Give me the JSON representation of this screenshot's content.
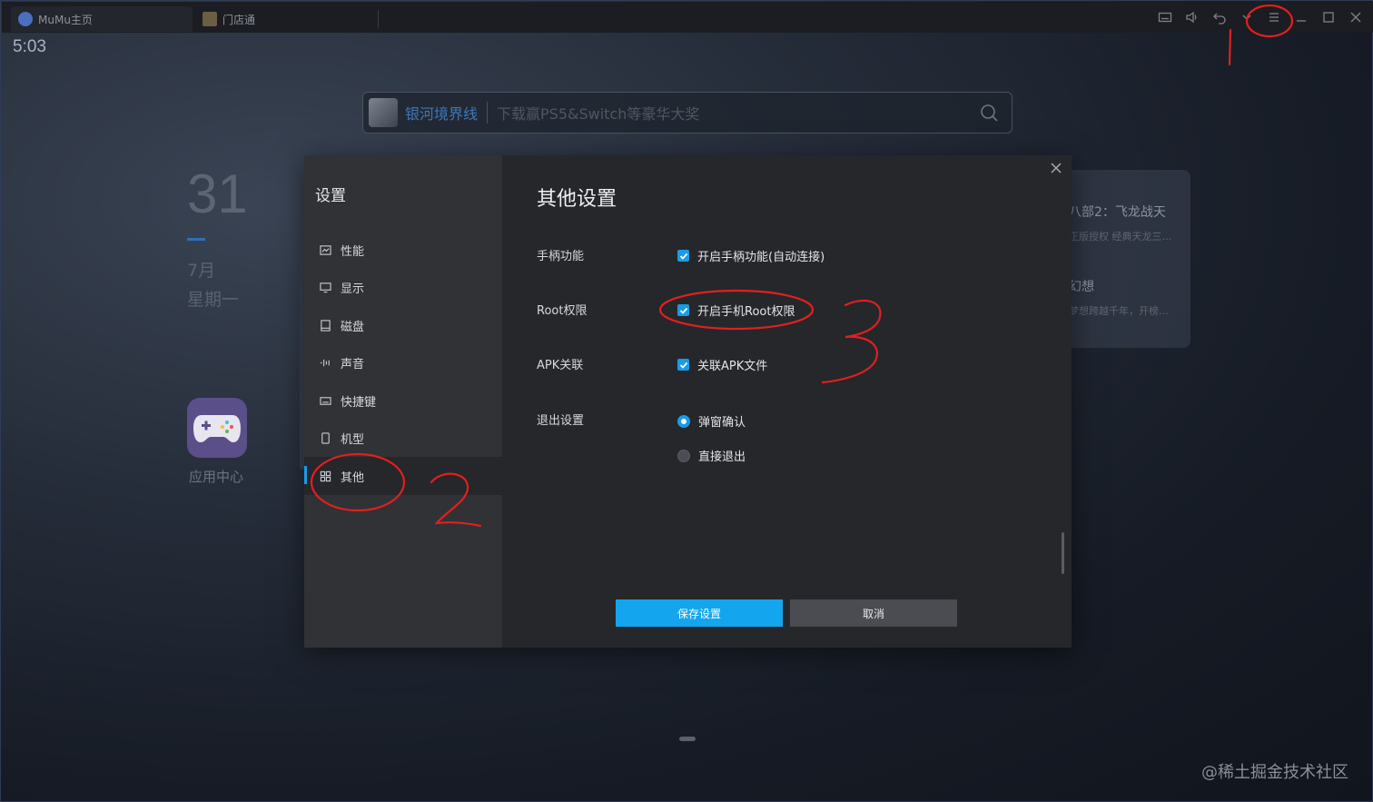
{
  "window": {
    "tabs": [
      {
        "label": "MuMu主页"
      },
      {
        "label": "门店通"
      }
    ]
  },
  "home": {
    "time": "5:03",
    "day": "31",
    "month": "7月",
    "weekday": "星期一",
    "app_center_label": "应用中心",
    "search": {
      "game_name": "银河境界线",
      "hint": "下载赢PS5&Switch等豪华大奖"
    },
    "bg_card": {
      "title1": "八部2：飞龙战天",
      "subtitle1": "正版授权 经典天龙三…",
      "title2": "幻想",
      "subtitle2": "梦想跨越千年，开榜…"
    }
  },
  "settings": {
    "sidebar_title": "设置",
    "sidebar_items": [
      {
        "label": "性能",
        "icon": "chart-icon"
      },
      {
        "label": "显示",
        "icon": "monitor-icon"
      },
      {
        "label": "磁盘",
        "icon": "disk-icon"
      },
      {
        "label": "声音",
        "icon": "sound-icon"
      },
      {
        "label": "快捷键",
        "icon": "keyboard-icon"
      },
      {
        "label": "机型",
        "icon": "phone-icon"
      },
      {
        "label": "其他",
        "icon": "grid-icon",
        "active": true
      }
    ],
    "title": "其他设置",
    "rows": {
      "gamepad": {
        "label": "手柄功能",
        "option": "开启手柄功能(自动连接)",
        "checked": true
      },
      "root": {
        "label": "Root权限",
        "option": "开启手机Root权限",
        "checked": true
      },
      "apk": {
        "label": "APK关联",
        "option": "关联APK文件",
        "checked": true
      },
      "exit": {
        "label": "退出设置",
        "options": [
          "弹窗确认",
          "直接退出"
        ],
        "selected": "弹窗确认"
      }
    },
    "save_label": "保存设置",
    "cancel_label": "取消"
  },
  "annotations": [
    "1",
    "2",
    "3"
  ],
  "watermark": "@稀土掘金技术社区",
  "colors": {
    "accent": "#13a6ee",
    "annotation": "#e0201f"
  }
}
